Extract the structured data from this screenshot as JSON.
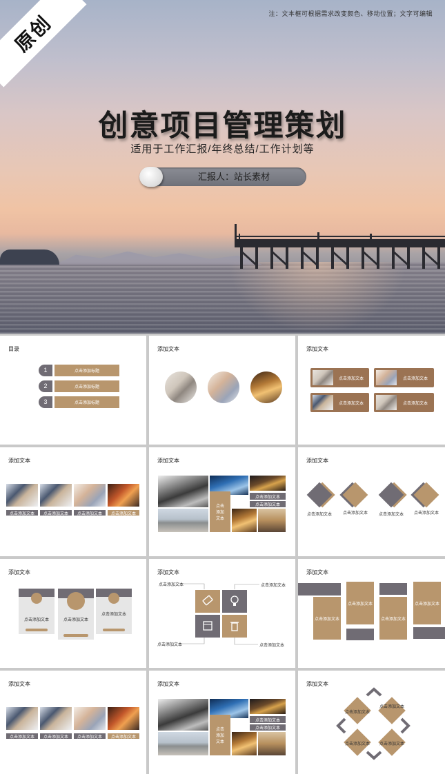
{
  "hero": {
    "ribbon": "原创",
    "note": "注：文本框可根据需求改变颜色、移动位置；文字可编辑",
    "title": "创意项目管理策划",
    "subtitle": "适用于工作汇报/年终总结/工作计划等",
    "reporter": "汇报人：站长素材"
  },
  "colors": {
    "accent_tan": "#b8966d",
    "accent_gray": "#706c74",
    "grid_gap": "#c9c9c9"
  },
  "slides": {
    "s1": {
      "title": "目录",
      "items": [
        {
          "num": "1",
          "label": "点击添加标题"
        },
        {
          "num": "2",
          "label": "点击添加标题"
        },
        {
          "num": "3",
          "label": "点击添加标题"
        }
      ]
    },
    "s2": {
      "title": "添加文本"
    },
    "s3": {
      "title": "添加文本",
      "labels": [
        "点击添加文本",
        "点击添加文本",
        "点击添加文本",
        "点击添加文本"
      ]
    },
    "s4": {
      "title": "添加文本",
      "labels": [
        "点击添加文本",
        "点击添加文本",
        "点击添加文本",
        "点击添加文本"
      ]
    },
    "s5": {
      "title": "添加文本",
      "center_text": "点击\n添加\n文本",
      "box_labels": [
        "点击添加文本",
        "点击添加文本"
      ]
    },
    "s6": {
      "title": "添加文本",
      "labels": [
        "点击添加文本",
        "点击添加文本",
        "点击添加文本",
        "点击添加文本"
      ]
    },
    "s7": {
      "title": "添加文本",
      "labels": [
        "点击添加文本",
        "点击添加文本",
        "点击添加文本"
      ]
    },
    "s8": {
      "title": "添加文本",
      "labels": [
        "点击添加文本",
        "点击添加文本",
        "点击添加文本",
        "点击添加文本"
      ]
    },
    "s9": {
      "title": "添加文本",
      "labels": [
        "点击添加文本",
        "点击添加文本",
        "点击添加文本",
        "点击添加文本"
      ]
    },
    "s10": {
      "title": "添加文本",
      "labels": [
        "点击添加文本",
        "点击添加文本",
        "点击添加文本",
        "点击添加文本"
      ]
    },
    "s11": {
      "title": "添加文本",
      "center_text": "点击\n添加\n文本",
      "box_labels": [
        "点击添加文本",
        "点击添加文本"
      ]
    },
    "s12": {
      "title": "添加文本",
      "labels": [
        "点击添加文本",
        "点击添加文本",
        "点击添加文本",
        "点击添加文本"
      ]
    }
  }
}
